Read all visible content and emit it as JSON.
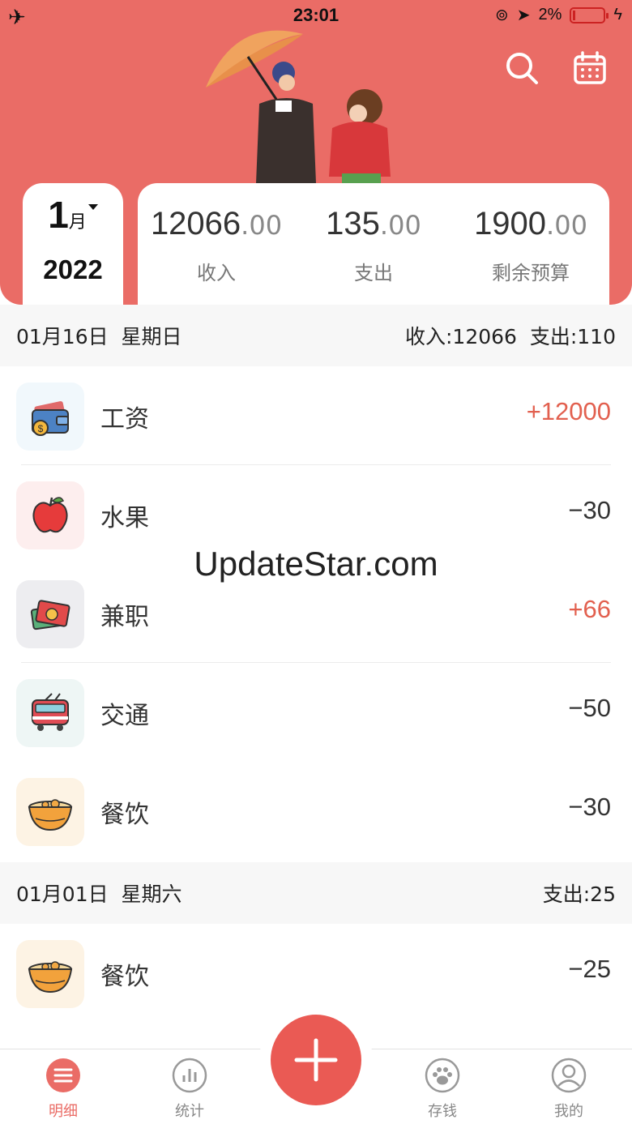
{
  "status_bar": {
    "time": "23:01",
    "battery": "2%"
  },
  "header": {
    "month": "1",
    "month_unit": "月",
    "year": "2022",
    "summary": [
      {
        "integer": "12066",
        "decimal": ".00",
        "label": "收入"
      },
      {
        "integer": "135",
        "decimal": ".00",
        "label": "支出"
      },
      {
        "integer": "1900",
        "decimal": ".00",
        "label": "剩余预算"
      }
    ]
  },
  "days": [
    {
      "date": "01月16日",
      "weekday": "星期日",
      "totals": "收入:12066  支出:110",
      "records": [
        {
          "category": "工资",
          "amount": "+12000",
          "type": "income",
          "icon": "wallet-icon"
        },
        {
          "category": "水果",
          "amount": "−30",
          "type": "expense",
          "icon": "apple-icon"
        },
        {
          "category": "兼职",
          "amount": "+66",
          "type": "income",
          "icon": "red-envelope-icon"
        },
        {
          "category": "交通",
          "amount": "−50",
          "type": "expense",
          "icon": "tram-icon"
        },
        {
          "category": "餐饮",
          "amount": "−30",
          "type": "expense",
          "icon": "noodle-bowl-icon"
        }
      ]
    },
    {
      "date": "01月01日",
      "weekday": "星期六",
      "totals": "支出:25",
      "records": [
        {
          "category": "餐饮",
          "amount": "−25",
          "type": "expense",
          "icon": "noodle-bowl-icon"
        }
      ]
    }
  ],
  "watermark": "UpdateStar.com",
  "tabs": [
    {
      "label": "明细",
      "icon": "list-icon",
      "active": true
    },
    {
      "label": "统计",
      "icon": "chart-icon",
      "active": false
    },
    {
      "label": "存钱",
      "icon": "paw-icon",
      "active": false
    },
    {
      "label": "我的",
      "icon": "user-icon",
      "active": false
    }
  ],
  "colors": {
    "accent": "#ea6c66",
    "income": "#e2604f"
  }
}
